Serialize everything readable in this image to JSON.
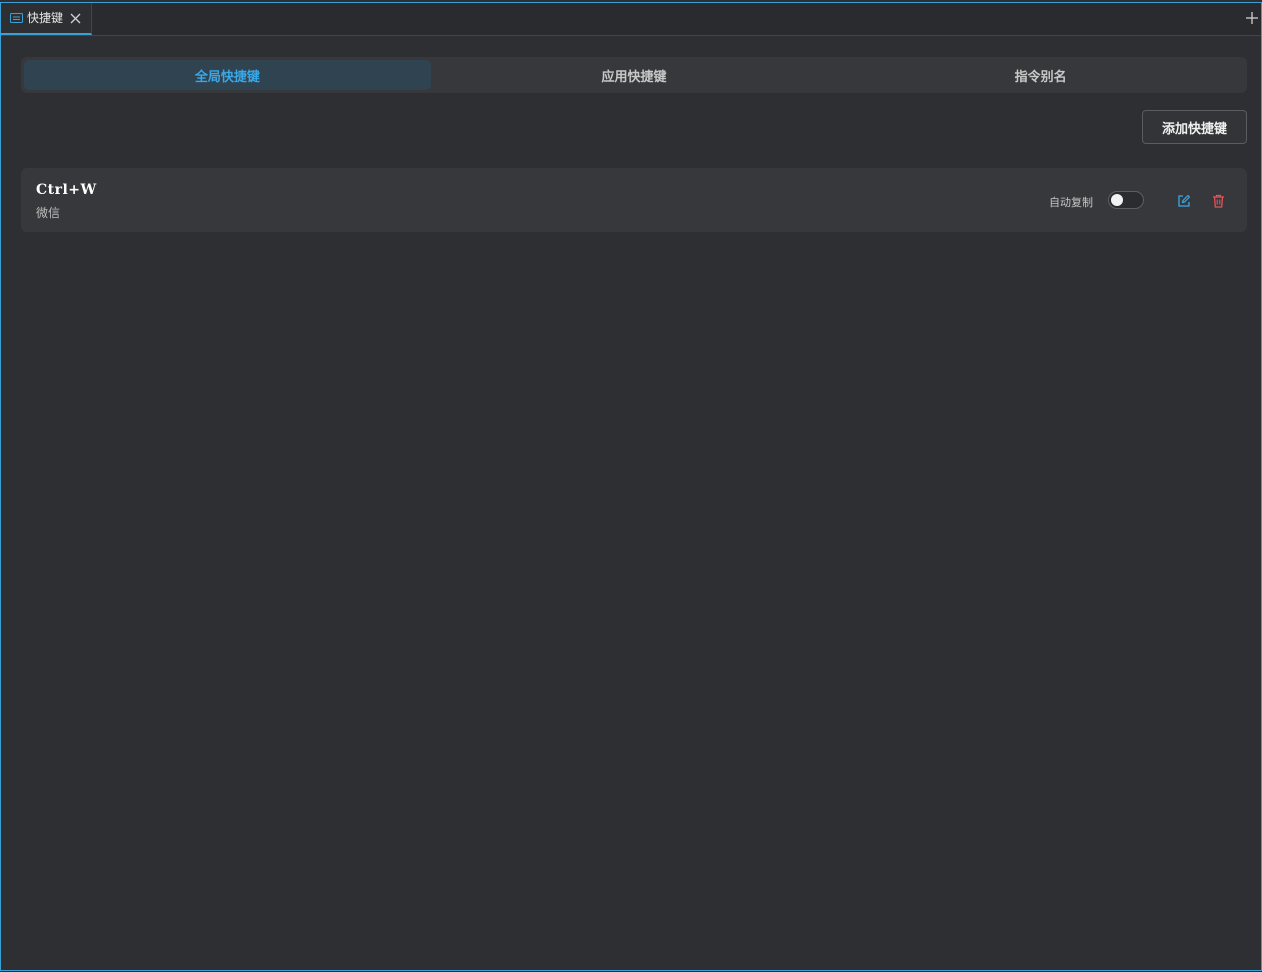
{
  "tab": {
    "label": "快捷键",
    "icon": "keyboard-icon",
    "close_icon": "close-icon",
    "add_icon": "plus-icon"
  },
  "segments": {
    "items": [
      {
        "label": "全局快捷键",
        "active": true
      },
      {
        "label": "应用快捷键",
        "active": false
      },
      {
        "label": "指令别名",
        "active": false
      }
    ]
  },
  "toolbar": {
    "add_label": "添加快捷键"
  },
  "shortcuts": [
    {
      "keys": "Ctrl+W",
      "app": "微信",
      "auto_copy_label": "自动复制",
      "auto_copy": false,
      "edit_icon": "edit-icon",
      "delete_icon": "trash-icon"
    }
  ],
  "colors": {
    "accent": "#3aa8e8",
    "danger": "#e0545a",
    "background": "#2e2f32"
  }
}
